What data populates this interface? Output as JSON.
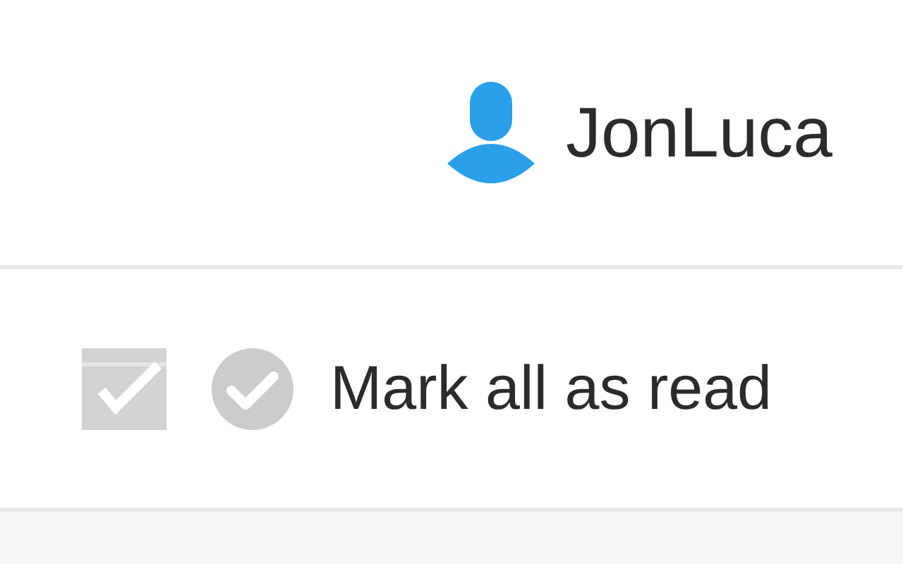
{
  "user": {
    "name": "JonLuca"
  },
  "action": {
    "label": "Mark all as read"
  }
}
